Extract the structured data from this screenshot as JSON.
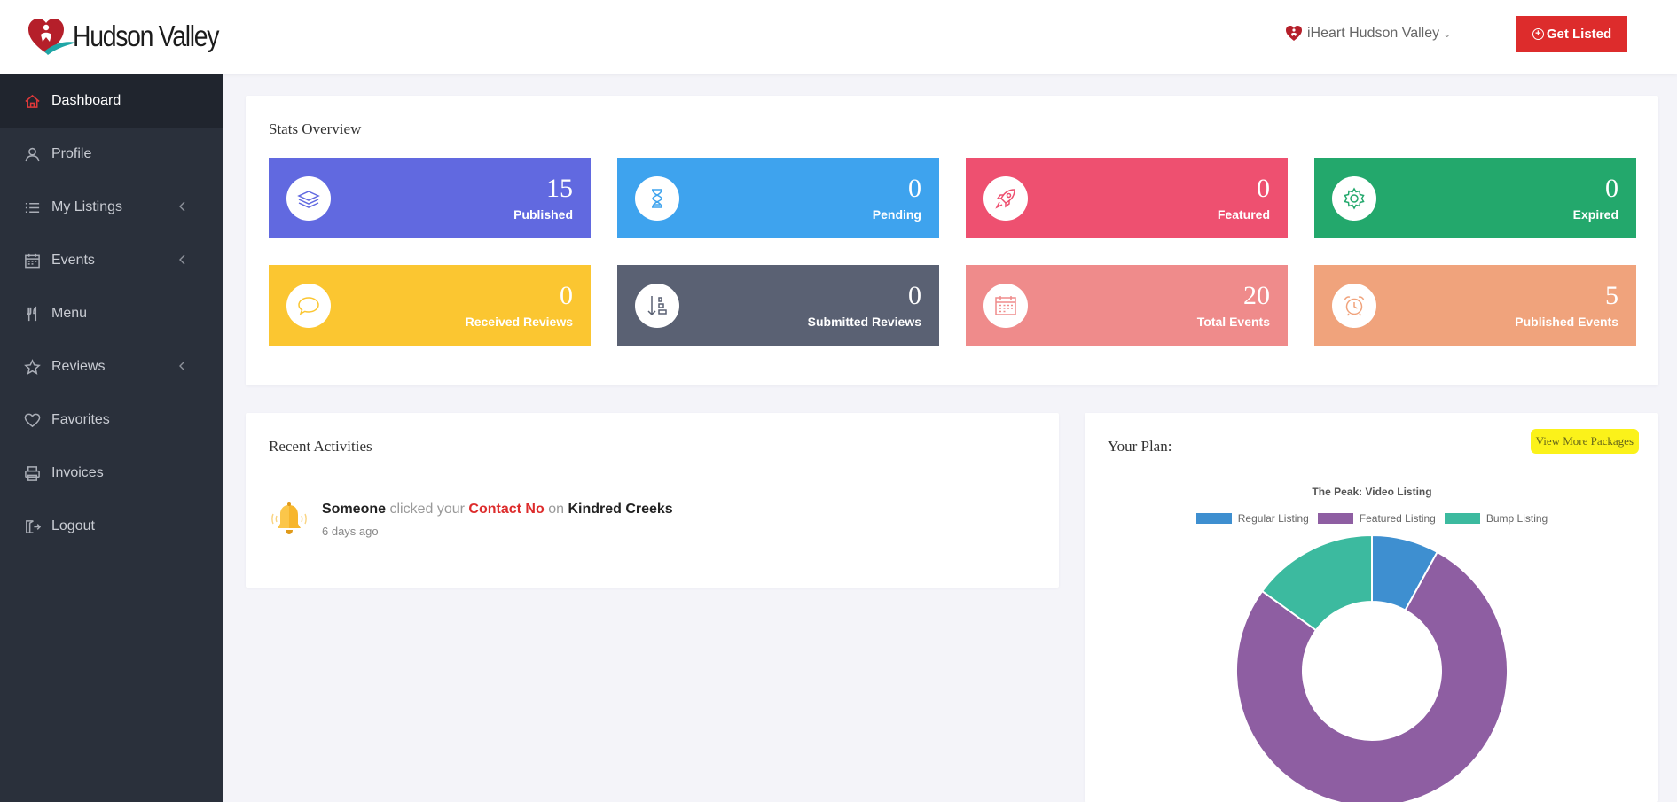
{
  "header": {
    "logo_text": "Hudson Valley",
    "account_name": "iHeart Hudson Valley",
    "get_listed_label": "Get Listed",
    "get_listed_color": "#dd2c2c"
  },
  "sidebar": {
    "items": [
      {
        "label": "Dashboard",
        "icon": "home-icon",
        "active": true
      },
      {
        "label": "Profile",
        "icon": "user-icon"
      },
      {
        "label": "My Listings",
        "icon": "list-icon",
        "has_children": true
      },
      {
        "label": "Events",
        "icon": "calendar-icon",
        "has_children": true
      },
      {
        "label": "Menu",
        "icon": "utensils-icon"
      },
      {
        "label": "Reviews",
        "icon": "star-icon",
        "has_children": true
      },
      {
        "label": "Favorites",
        "icon": "heart-icon"
      },
      {
        "label": "Invoices",
        "icon": "printer-icon"
      },
      {
        "label": "Logout",
        "icon": "logout-icon"
      }
    ]
  },
  "stats": {
    "title": "Stats Overview",
    "cards": [
      {
        "value": "15",
        "label": "Published",
        "color": "#6169e0",
        "icon": "layers-icon"
      },
      {
        "value": "0",
        "label": "Pending",
        "color": "#3ea3ee",
        "icon": "hourglass-icon"
      },
      {
        "value": "0",
        "label": "Featured",
        "color": "#ee5070",
        "icon": "rocket-icon"
      },
      {
        "value": "0",
        "label": "Expired",
        "color": "#23a86c",
        "icon": "gear-icon"
      },
      {
        "value": "0",
        "label": "Received Reviews",
        "color": "#fbc631",
        "icon": "speech-bubble-icon"
      },
      {
        "value": "0",
        "label": "Submitted Reviews",
        "color": "#5a6173",
        "icon": "sort-descending-icon"
      },
      {
        "value": "20",
        "label": "Total Events",
        "color": "#ef8b8b",
        "icon": "calendar-icon"
      },
      {
        "value": "5",
        "label": "Published Events",
        "color": "#f0a37c",
        "icon": "alarm-clock-icon"
      }
    ]
  },
  "recent": {
    "title": "Recent Activities",
    "items": [
      {
        "actor": "Someone",
        "verb": "clicked your",
        "target": "Contact No",
        "prep": "on",
        "listing": "Kindred Creeks",
        "time": "6 days ago"
      }
    ]
  },
  "plan": {
    "title": "Your Plan:",
    "view_more_label": "View More Packages",
    "view_more_highlight": "#fbf21a"
  },
  "chart_data": {
    "type": "pie",
    "variant": "doughnut",
    "title": "The Peak: Video Listing",
    "legend_position": "top",
    "categories": [
      "Regular Listing",
      "Featured Listing",
      "Bump Listing"
    ],
    "values": [
      8,
      77,
      15
    ],
    "colors": [
      "#3e8fd0",
      "#8e5ea2",
      "#3cba9f"
    ]
  }
}
